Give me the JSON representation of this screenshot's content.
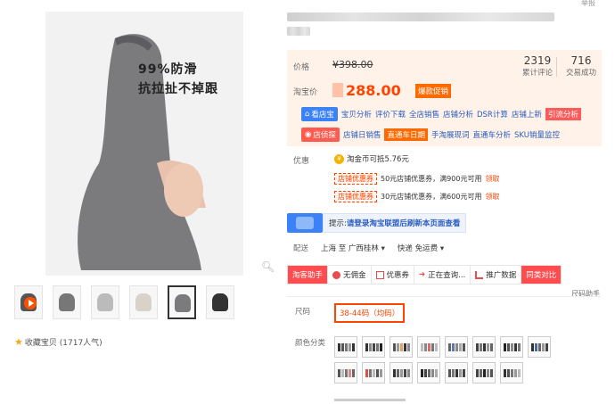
{
  "top_right_link": "举报",
  "product_image": {
    "promo_line1": "99%防滑",
    "promo_line2": "抗拉扯不掉跟"
  },
  "favorite": {
    "label": "收藏宝贝",
    "count": "(1717人气)"
  },
  "price": {
    "label": "价格",
    "original": "¥398.00",
    "tb_label": "淘宝价",
    "current": "288.00",
    "hot_tag": "爆款促销"
  },
  "stats": {
    "reviews": {
      "value": "2319",
      "label": "累计评论"
    },
    "sales": {
      "value": "716",
      "label": "交易成功"
    }
  },
  "tools_row1": {
    "badge": "看店宝",
    "items": [
      "宝贝分析",
      "评价下载",
      "全店销售",
      "店铺分析",
      "DSR计算",
      "店铺上新"
    ],
    "highlight": "引流分析"
  },
  "tools_row2": {
    "badge": "店侦探",
    "items": [
      "店铺日销售"
    ],
    "highlight": "直通车日期",
    "items_after": [
      "手淘展现词",
      "直通车分析",
      "SKU销量监控"
    ]
  },
  "promo": {
    "label": "优惠",
    "coin_text": "淘金币可抵5.76元",
    "coupons": [
      {
        "tag": "店铺优惠券",
        "text": "50元店铺优惠券，满900元可用",
        "get": "领取"
      },
      {
        "tag": "店铺优惠券",
        "text": "30元店铺优惠券，满600元可用",
        "get": "领取"
      }
    ]
  },
  "login_tip": {
    "prefix": "提示:",
    "link": "请登录淘宝联盟后刷新本页面查看"
  },
  "shipping": {
    "label": "配送",
    "from": "上海 至",
    "to": "广西桂林",
    "express": "快递 免运费"
  },
  "assist_bar": {
    "title": "淘客助手",
    "items": [
      "无佣金",
      "优惠券",
      "正在查询...",
      "推广数据"
    ],
    "compare": "同类对比",
    "size_helper": "尺码助手"
  },
  "size": {
    "label": "尺码",
    "option": "38-44码（均码）"
  },
  "color": {
    "label": "颜色分类"
  }
}
